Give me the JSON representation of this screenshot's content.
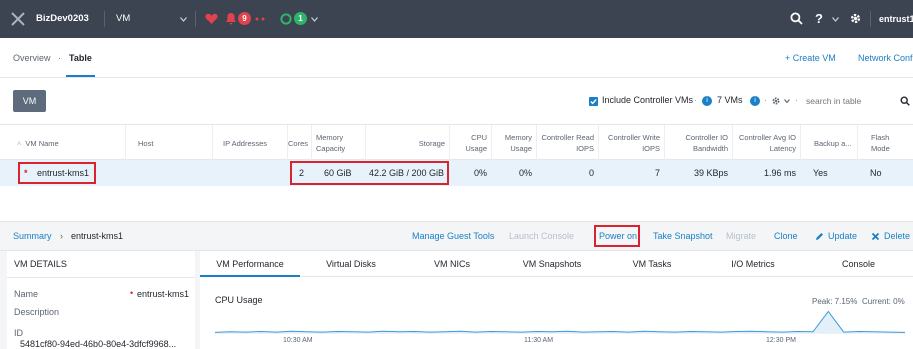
{
  "topbar": {
    "cluster_name": "BizDev0203",
    "module": "VM",
    "alert_count": "9",
    "task_count": "1",
    "help": "?",
    "user": "entrust1"
  },
  "tabs": {
    "overview": "Overview",
    "separator": "·",
    "table": "Table",
    "create_vm": "+ Create VM",
    "network_config": "Network Confi"
  },
  "toolbar": {
    "vm_button": "VM",
    "include_controller": "Include Controller VMs",
    "sep": "·",
    "vm_count": "7 VMs",
    "search_placeholder": "search in table"
  },
  "table": {
    "headers": {
      "vm_name": "VM Name",
      "host": "Host",
      "ip": "IP Addresses",
      "cores": "Cores",
      "memory": "Memory Capacity",
      "storage": "Storage",
      "cpu": "CPU Usage",
      "mem_usage": "Memory Usage",
      "ctrl_read": "Controller Read IOPS",
      "ctrl_write": "Controller Write IOPS",
      "ctrl_io": "Controller IO Bandwidth",
      "ctrl_lat": "Controller Avg IO Latency",
      "backup": "Backup a...",
      "flash": "Flash Mode"
    },
    "row": {
      "marker": "*",
      "vm_name": "entrust-kms1",
      "host": "",
      "ip": "",
      "cores": "2",
      "memory": "60 GiB",
      "storage": "42.2 GiB / 200 GiB",
      "cpu": "0%",
      "mem_usage": "0%",
      "ctrl_read": "0",
      "ctrl_write": "7",
      "ctrl_io": "39 KBps",
      "ctrl_lat": "1.96 ms",
      "backup": "Yes",
      "flash": "No"
    }
  },
  "summary": {
    "breadcrumb_root": "Summary",
    "breadcrumb_arrow": "›",
    "breadcrumb_vm": "entrust-kms1"
  },
  "actions": {
    "manage_guest_tools": "Manage Guest Tools",
    "launch_console": "Launch Console",
    "power_on": "Power on",
    "take_snapshot": "Take Snapshot",
    "migrate": "Migrate",
    "clone": "Clone",
    "update": "Update",
    "delete": "Delete"
  },
  "details": {
    "title": "VM DETAILS",
    "name_label": "Name",
    "name_value": "entrust-kms1",
    "description_label": "Description",
    "id_label": "ID",
    "id_value": "5481cf80-94ed-46b0-80e4-3dfcf9968..."
  },
  "perf_tabs": [
    "VM Performance",
    "Virtual Disks",
    "VM NICs",
    "VM Snapshots",
    "VM Tasks",
    "I/O Metrics",
    "Console"
  ],
  "chart": {
    "title": "CPU Usage",
    "peak": "Peak: 7.15%",
    "current": "Current: 0%",
    "xticks": [
      "10:30 AM",
      "11:30 AM",
      "12:30 PM"
    ]
  },
  "chart_data": {
    "type": "line",
    "title": "CPU Usage",
    "series": [
      {
        "name": "",
        "values": [
          0.2,
          0.4,
          0.3,
          0.5,
          0.3,
          0.6,
          0.4,
          0.3,
          0.5,
          0.4,
          0.3,
          0.6,
          0.4,
          0.5,
          0.3,
          0.4,
          0.6,
          0.3,
          0.5,
          0.4,
          0.3,
          0.5,
          0.4,
          0.6,
          0.3,
          0.4,
          0.5,
          0.3,
          0.6,
          0.4,
          0.3,
          0.5,
          0.4,
          0.3,
          0.5,
          0.6,
          0.4,
          0.3,
          0.5,
          0.4,
          7.15,
          0.3,
          0.5,
          0.4,
          0.3,
          0.2
        ]
      }
    ],
    "x_ticks": [
      "10:30 AM",
      "11:30 AM",
      "12:30 PM"
    ],
    "ylim": [
      0,
      8
    ],
    "peak": "7.15%",
    "current": "0%"
  },
  "colors": {
    "topbar": "#3c4351",
    "accent": "#1a7fc4",
    "highlight": "#d9232e",
    "selected_row": "#e8f2fb",
    "alert_red": "#e0424e",
    "task_green": "#2fb36a"
  }
}
